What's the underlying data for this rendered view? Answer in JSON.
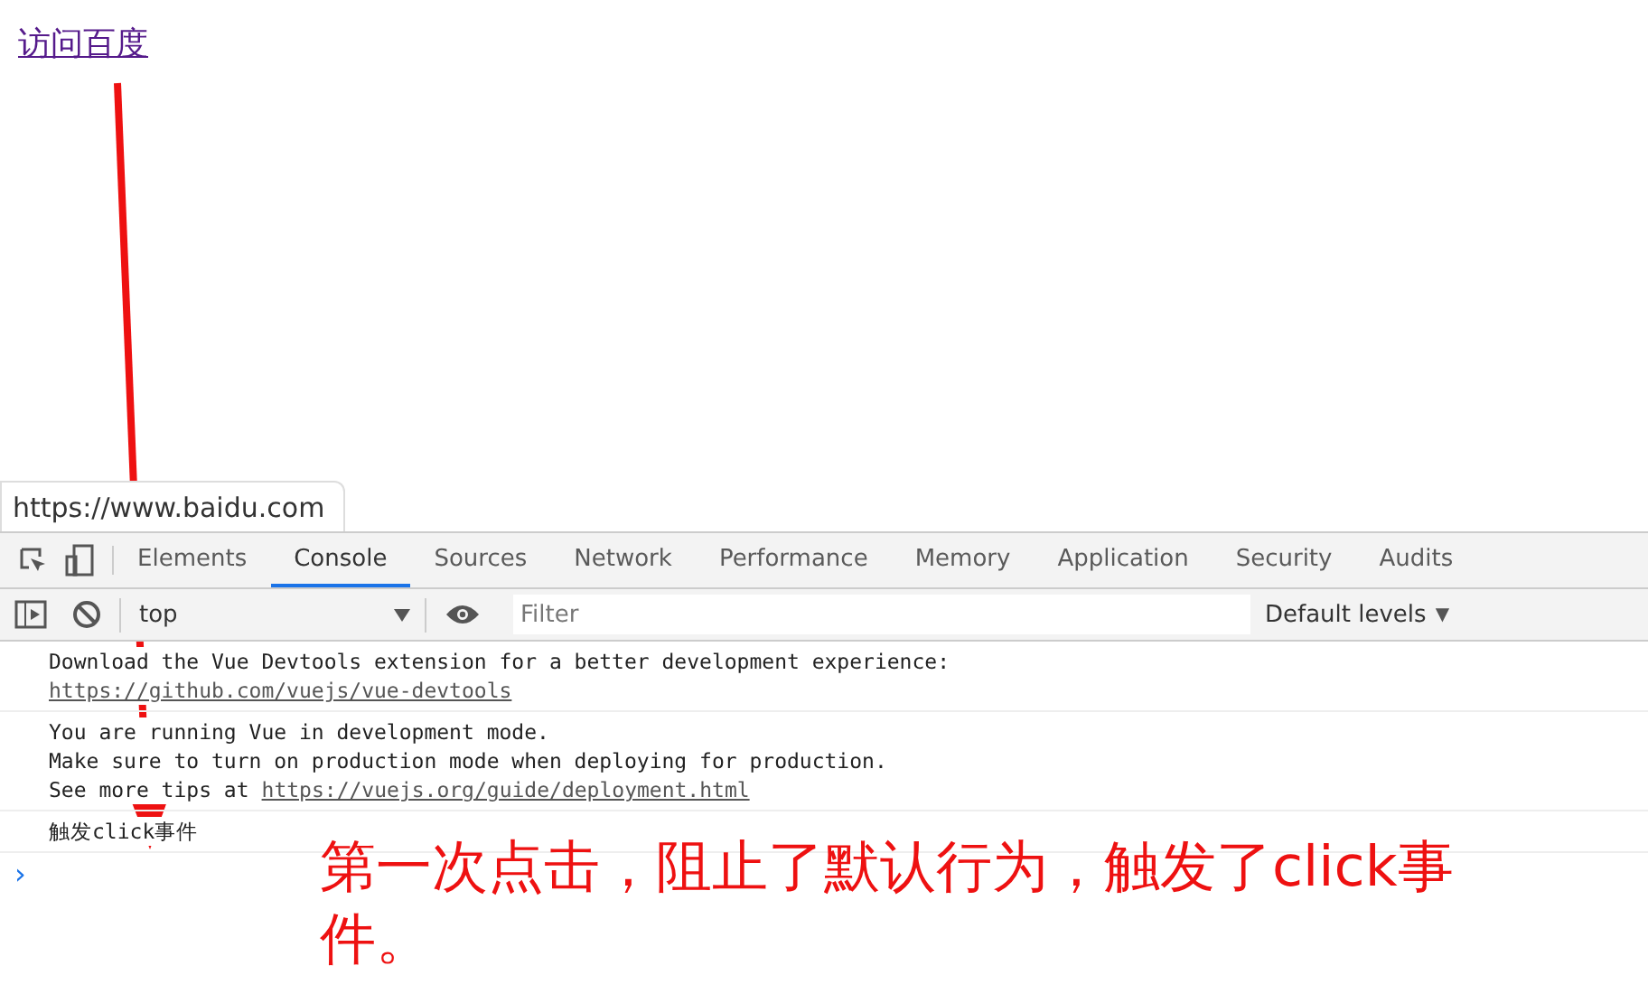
{
  "page": {
    "link": "访问百度"
  },
  "status_url": "https://www.baidu.com",
  "devtools": {
    "tabs": [
      {
        "label": "Elements",
        "selected": false
      },
      {
        "label": "Console",
        "selected": true
      },
      {
        "label": "Sources",
        "selected": false
      },
      {
        "label": "Network",
        "selected": false
      },
      {
        "label": "Performance",
        "selected": false
      },
      {
        "label": "Memory",
        "selected": false
      },
      {
        "label": "Application",
        "selected": false
      },
      {
        "label": "Security",
        "selected": false
      },
      {
        "label": "Audits",
        "selected": false
      }
    ],
    "context": "top",
    "filter": {
      "placeholder": "Filter"
    },
    "levels": "Default levels",
    "levels_caret": "▼",
    "messages": [
      {
        "lines": [
          {
            "text": "Download the Vue Devtools extension for a better development experience:"
          },
          {
            "link": "https://github.com/vuejs/vue-devtools"
          }
        ]
      },
      {
        "lines": [
          {
            "text": "You are running Vue in development mode."
          },
          {
            "text": "Make sure to turn on production mode when deploying for production."
          },
          {
            "text": "See more tips at",
            "link": "https://vuejs.org/guide/deployment.html"
          }
        ]
      },
      {
        "lines": [
          {
            "text": "触发click事件"
          }
        ]
      }
    ],
    "prompt": "›"
  },
  "annotation": "第一次点击，阻止了默认行为，触发了click事件。"
}
